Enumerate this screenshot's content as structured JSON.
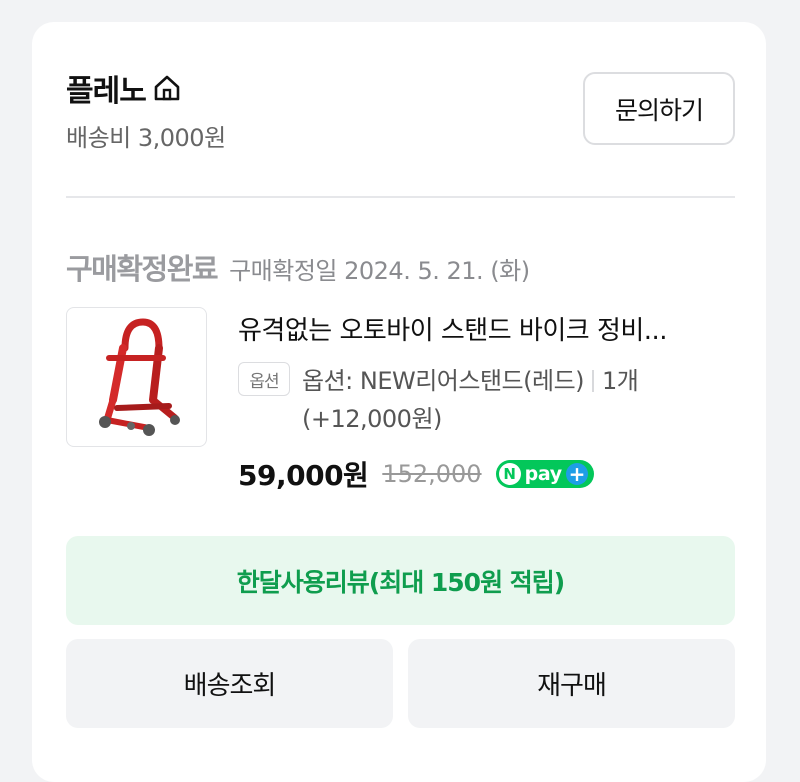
{
  "store": {
    "name": "플레노",
    "home_icon": "home-icon",
    "shipping_fee": "배송비 3,000원",
    "inquiry_label": "문의하기"
  },
  "order": {
    "status": "구매확정완료",
    "confirm_date": "구매확정일 2024. 5. 21. (화)"
  },
  "product": {
    "title": "유격없는 오토바이 스탠드 바이크 정비...",
    "option_badge": "옵션",
    "option_name": "옵션: NEW리어스탠드(레드)",
    "option_qty": "1개 (+12,000원)",
    "price": "59,000원",
    "original_price": "152,000",
    "pay_badge": "pay",
    "pay_badge_n": "N",
    "pay_badge_plus": "+"
  },
  "actions": {
    "review_label": "한달사용리뷰(최대 150원 적립)",
    "track_label": "배송조회",
    "rebuy_label": "재구매"
  },
  "colors": {
    "accent_green": "#0f9d4e",
    "review_bg": "#e8f8ee",
    "npay_green": "#03c75a",
    "product_red": "#d42a2a"
  }
}
